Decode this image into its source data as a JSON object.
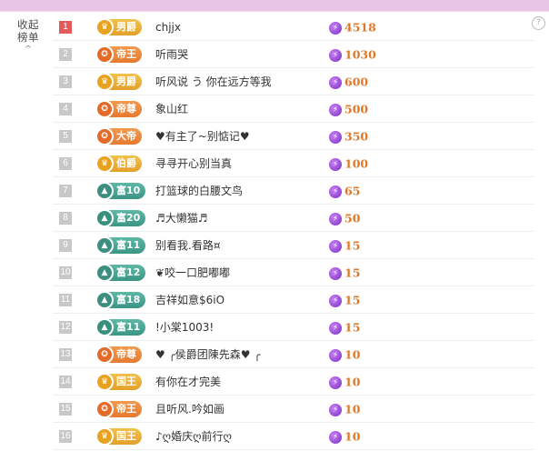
{
  "sidebar": {
    "collapse_label": "收起榜单",
    "collapse_arrow": "^"
  },
  "help_icon": "?",
  "score_icon": "bolt-icon",
  "rows": [
    {
      "rank": "1",
      "badge": "男爵",
      "badge_style": "gold",
      "badge_icon": "crown-icon",
      "name": "chjjx",
      "score": "4518"
    },
    {
      "rank": "2",
      "badge": "帝王",
      "badge_style": "orange",
      "badge_icon": "emperor-icon",
      "name": "听雨哭",
      "score": "1030"
    },
    {
      "rank": "3",
      "badge": "男爵",
      "badge_style": "gold",
      "badge_icon": "crown-icon",
      "name": "听风说 う 你在远方等我",
      "score": "600"
    },
    {
      "rank": "4",
      "badge": "帝尊",
      "badge_style": "orange",
      "badge_icon": "emperor-icon",
      "name": "象山红",
      "score": "500"
    },
    {
      "rank": "5",
      "badge": "大帝",
      "badge_style": "orange",
      "badge_icon": "emperor-icon",
      "name": "♥有主了~别惦记♥",
      "score": "350"
    },
    {
      "rank": "6",
      "badge": "伯爵",
      "badge_style": "gold",
      "badge_icon": "crown-icon",
      "name": "寻寻开心别当真",
      "score": "100"
    },
    {
      "rank": "7",
      "badge": "富10",
      "badge_style": "teal",
      "badge_icon": "wealth-icon",
      "name": "打篮球的白腰文鸟",
      "score": "65"
    },
    {
      "rank": "8",
      "badge": "富20",
      "badge_style": "teal",
      "badge_icon": "wealth-icon",
      "name": "♬大懒猫♬",
      "score": "50"
    },
    {
      "rank": "9",
      "badge": "富11",
      "badge_style": "teal",
      "badge_icon": "wealth-icon",
      "name": "别看我.看路¤",
      "score": "15"
    },
    {
      "rank": "10",
      "badge": "富12",
      "badge_style": "teal",
      "badge_icon": "wealth-icon",
      "name": "❦咬一口肥嘟嘟",
      "score": "15"
    },
    {
      "rank": "11",
      "badge": "富18",
      "badge_style": "teal",
      "badge_icon": "wealth-icon",
      "name": "吉祥如意$6iO",
      "score": "15"
    },
    {
      "rank": "12",
      "badge": "富11",
      "badge_style": "teal",
      "badge_icon": "wealth-icon",
      "name": "!小棠1003!",
      "score": "15"
    },
    {
      "rank": "13",
      "badge": "帝尊",
      "badge_style": "orange",
      "badge_icon": "emperor-icon",
      "name": "♥ ╭侯爵团陳先森♥ ╭",
      "score": "10"
    },
    {
      "rank": "14",
      "badge": "国王",
      "badge_style": "gold",
      "badge_icon": "crown-icon",
      "name": "有你在才完美",
      "score": "10"
    },
    {
      "rank": "15",
      "badge": "帝王",
      "badge_style": "orange",
      "badge_icon": "emperor-icon",
      "name": "且听风.吟如画",
      "score": "10"
    },
    {
      "rank": "16",
      "badge": "国王",
      "badge_style": "gold",
      "badge_icon": "crown-icon",
      "name": "♪ღ婚庆ღ前行ღ",
      "score": "10"
    }
  ]
}
